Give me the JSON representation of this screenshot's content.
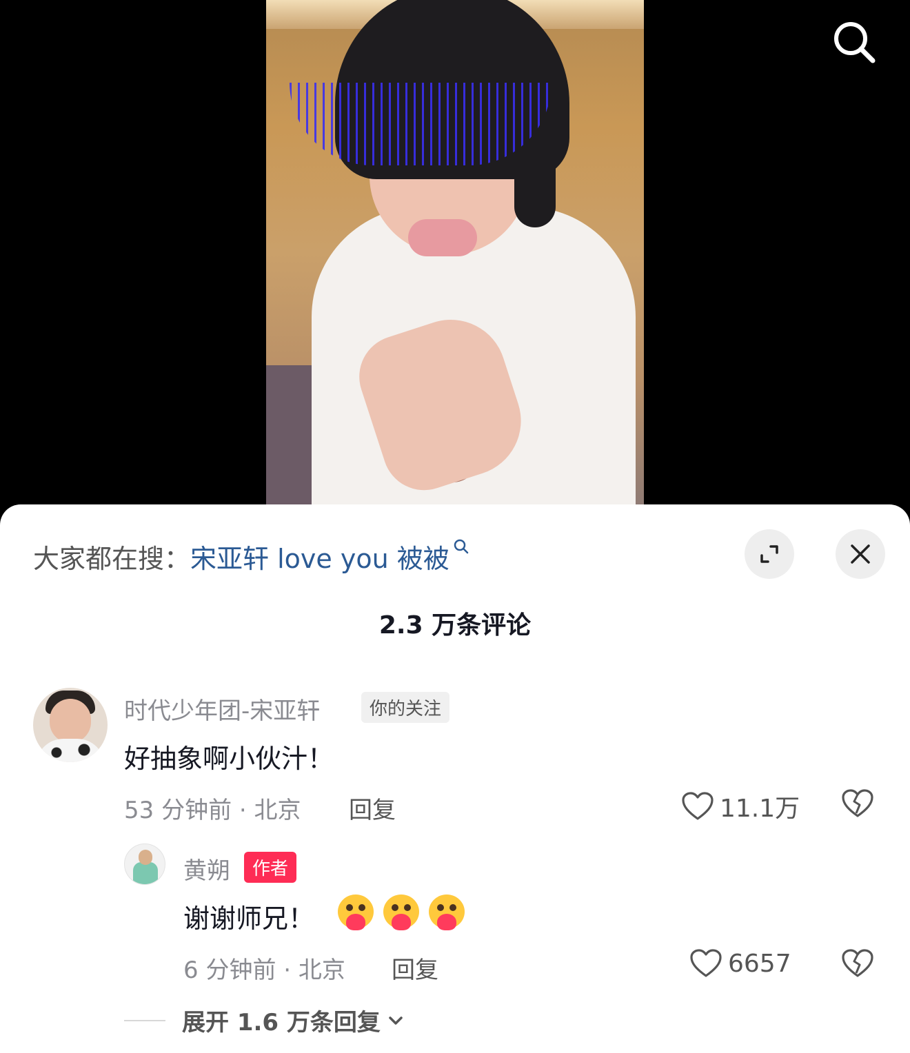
{
  "hot_search": {
    "prefix": "大家都在搜：",
    "term": "宋亚轩 love you 被被"
  },
  "header": {
    "title": "2.3 万条评论"
  },
  "comments": [
    {
      "username": "时代少年团-宋亚轩",
      "tag": "你的关注",
      "text": "好抽象啊小伙汁！",
      "meta": "53 分钟前 · 北京",
      "reply_label": "回复",
      "likes": "11.1万"
    },
    {
      "username": "黄朔",
      "tag": "作者",
      "text": "谢谢师兄！",
      "meta": "6 分钟前 · 北京",
      "reply_label": "回复",
      "likes": "6657"
    }
  ],
  "expand_replies": "展开 1.6 万条回复",
  "colors": {
    "link": "#2b5a94",
    "author_tag": "#fe2c55",
    "muted_text": "#8a8b91"
  },
  "icons": [
    "search-icon",
    "search-small-icon",
    "expand-icon",
    "close-icon",
    "heart-icon",
    "broken-heart-icon",
    "chevron-down-icon"
  ]
}
